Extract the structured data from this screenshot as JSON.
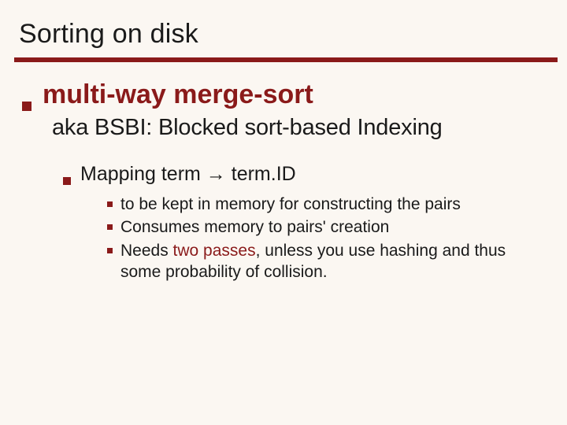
{
  "title": "Sorting on disk",
  "lvl1": "multi-way merge-sort",
  "subtitle": "aka BSBI: Blocked sort-based Indexing",
  "lvl2_pre": "Mapping term ",
  "lvl2_arrow": "→",
  "lvl2_post": " term.ID",
  "lvl3": {
    "a": "to be kept in memory for constructing the pairs",
    "b": "Consumes memory to pairs' creation",
    "c_pre": "Needs ",
    "c_accent": "two passes",
    "c_post": ", unless you use hashing and thus some probability of collision."
  }
}
